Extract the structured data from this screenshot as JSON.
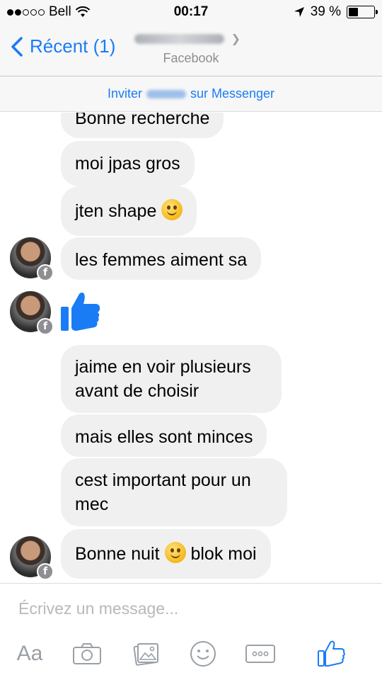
{
  "status_bar": {
    "carrier": "Bell",
    "time": "00:17",
    "battery_percent": "39 %",
    "battery_level": 0.39
  },
  "nav": {
    "back_label": "Récent (1)",
    "subtitle": "Facebook"
  },
  "invite": {
    "prefix": "Inviter",
    "suffix": "sur Messenger"
  },
  "messages": [
    {
      "text": "Bonne recherche"
    },
    {
      "text": "moi jpas gros"
    },
    {
      "text": "jten shape",
      "emoji": "winking-face"
    },
    {
      "text": "les femmes aiment sa"
    },
    {
      "sticker": "thumbs-up"
    },
    {
      "text": "jaime en voir plusieurs avant de choisir"
    },
    {
      "text": "mais elles sont minces"
    },
    {
      "text": "cest important pour un mec"
    },
    {
      "text_before": "Bonne nuit",
      "emoji": "smiling-face",
      "text_after": "blok moi"
    }
  ],
  "composer": {
    "placeholder": "Écrivez un message...",
    "aa_label": "Aa",
    "tools": [
      "text-size-icon",
      "camera-icon",
      "gallery-icon",
      "emoji-icon",
      "more-icon",
      "like-icon"
    ]
  },
  "colors": {
    "accent": "#1a7cf5",
    "bubble": "#f1f0f0",
    "icon_gray": "#9aa0a6"
  }
}
